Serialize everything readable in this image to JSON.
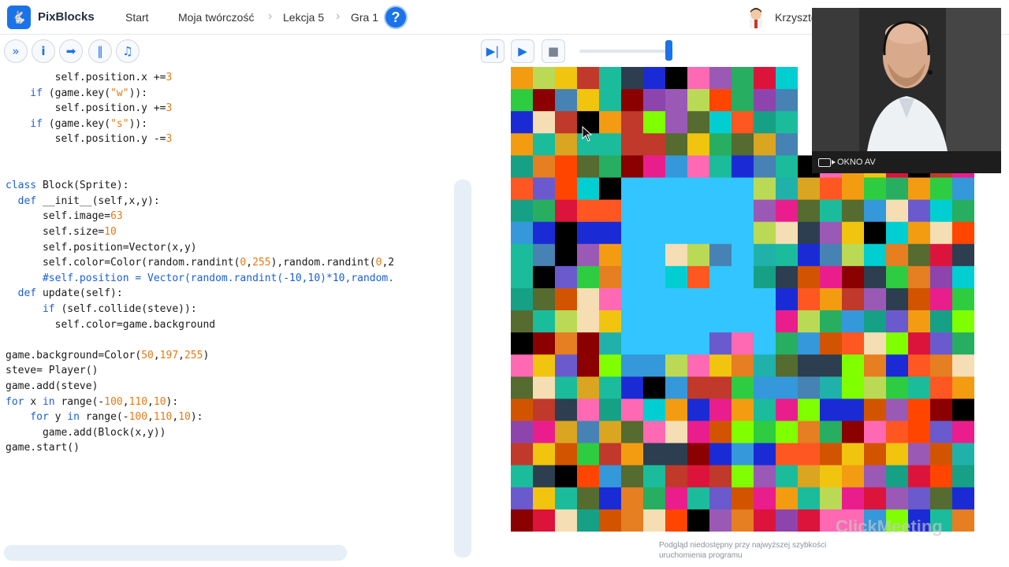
{
  "app": {
    "logo": "PixBlocks"
  },
  "nav": {
    "start": "Start",
    "my_work": "Moja twórczość",
    "lesson": "Lekcja 5",
    "game": "Gra 1",
    "help": "?"
  },
  "user": {
    "name": "Krzysztof"
  },
  "toolbar": {
    "left_buttons": [
      "fast-forward-icon",
      "info-icon",
      "step-arrow-icon",
      "pause-bars-icon",
      "music-note-icon"
    ],
    "right_buttons": [
      "skip-forward-icon",
      "play-icon",
      "stop-icon"
    ],
    "speed_level": 0.95
  },
  "code": {
    "lines": [
      [
        [
          "",
          "        self.position.x +="
        ],
        [
          "num",
          "3"
        ]
      ],
      [
        [
          "kw",
          "    if "
        ],
        [
          "",
          "(game.key("
        ],
        [
          "num",
          "\"w\""
        ],
        [
          "",
          ")):"
        ]
      ],
      [
        [
          "",
          "        self.position.y +="
        ],
        [
          "num",
          "3"
        ]
      ],
      [
        [
          "kw",
          "    if "
        ],
        [
          "",
          "(game.key("
        ],
        [
          "num",
          "\"s\""
        ],
        [
          "",
          ")):"
        ]
      ],
      [
        [
          "",
          "        self.position.y -="
        ],
        [
          "num",
          "3"
        ]
      ],
      [],
      [],
      [
        [
          "kw",
          "class "
        ],
        [
          "",
          "Block(Sprite):"
        ]
      ],
      [
        [
          "kw",
          "  def "
        ],
        [
          "",
          "__init__(self,x,y):"
        ]
      ],
      [
        [
          "",
          "      self.image="
        ],
        [
          "num",
          "63"
        ]
      ],
      [
        [
          "",
          "      self.size="
        ],
        [
          "num",
          "10"
        ]
      ],
      [
        [
          "",
          "      self.position=Vector(x,y)"
        ]
      ],
      [
        [
          "",
          "      self.color=Color(random.randint("
        ],
        [
          "num",
          "0"
        ],
        [
          "",
          ","
        ],
        [
          "num",
          "255"
        ],
        [
          "",
          "),random.randint("
        ],
        [
          "num",
          "0"
        ],
        [
          "",
          ",2"
        ]
      ],
      [
        [
          "cm",
          "      #self.position = Vector(random.randint(-10,10)*10,random."
        ]
      ],
      [
        [
          "kw",
          "  def "
        ],
        [
          "",
          "update(self):"
        ]
      ],
      [
        [
          "kw",
          "      if "
        ],
        [
          "",
          "(self.collide(steve)):"
        ]
      ],
      [
        [
          "",
          "        self.color=game.background"
        ]
      ],
      [],
      [
        [
          "",
          "game.background=Color("
        ],
        [
          "num",
          "50"
        ],
        [
          "",
          ","
        ],
        [
          "num",
          "197"
        ],
        [
          "",
          ","
        ],
        [
          "num",
          "255"
        ],
        [
          "",
          ")"
        ]
      ],
      [
        [
          "",
          "steve= Player()"
        ]
      ],
      [
        [
          "",
          "game.add(steve)"
        ]
      ],
      [
        [
          "kw",
          "for "
        ],
        [
          "",
          "x "
        ],
        [
          "kw",
          "in "
        ],
        [
          "",
          "range(-"
        ],
        [
          "num",
          "100"
        ],
        [
          "",
          ","
        ],
        [
          "num",
          "110"
        ],
        [
          "",
          ","
        ],
        [
          "num",
          "10"
        ],
        [
          "",
          "):"
        ]
      ],
      [
        [
          "kw",
          "    for "
        ],
        [
          "",
          "y "
        ],
        [
          "kw",
          "in "
        ],
        [
          "",
          "range(-"
        ],
        [
          "num",
          "100"
        ],
        [
          "",
          ","
        ],
        [
          "num",
          "110"
        ],
        [
          "",
          ","
        ],
        [
          "num",
          "10"
        ],
        [
          "",
          "):"
        ]
      ],
      [
        [
          "",
          "      game.add(Block(x,y))"
        ]
      ],
      [
        [
          "",
          "game.start()"
        ]
      ]
    ]
  },
  "stage": {
    "background": "#32c5ff",
    "hint": "Podgląd niedostępny przy najwyższej szybkości uruchomienia programu",
    "watermark": "ClickMeeting"
  },
  "video": {
    "caption": "OKNO AV"
  },
  "colors": {
    "accent": "#1a73e8",
    "keyword": "#1a5fd6",
    "number": "#e67a14",
    "game_bg": "#32c5ff"
  }
}
